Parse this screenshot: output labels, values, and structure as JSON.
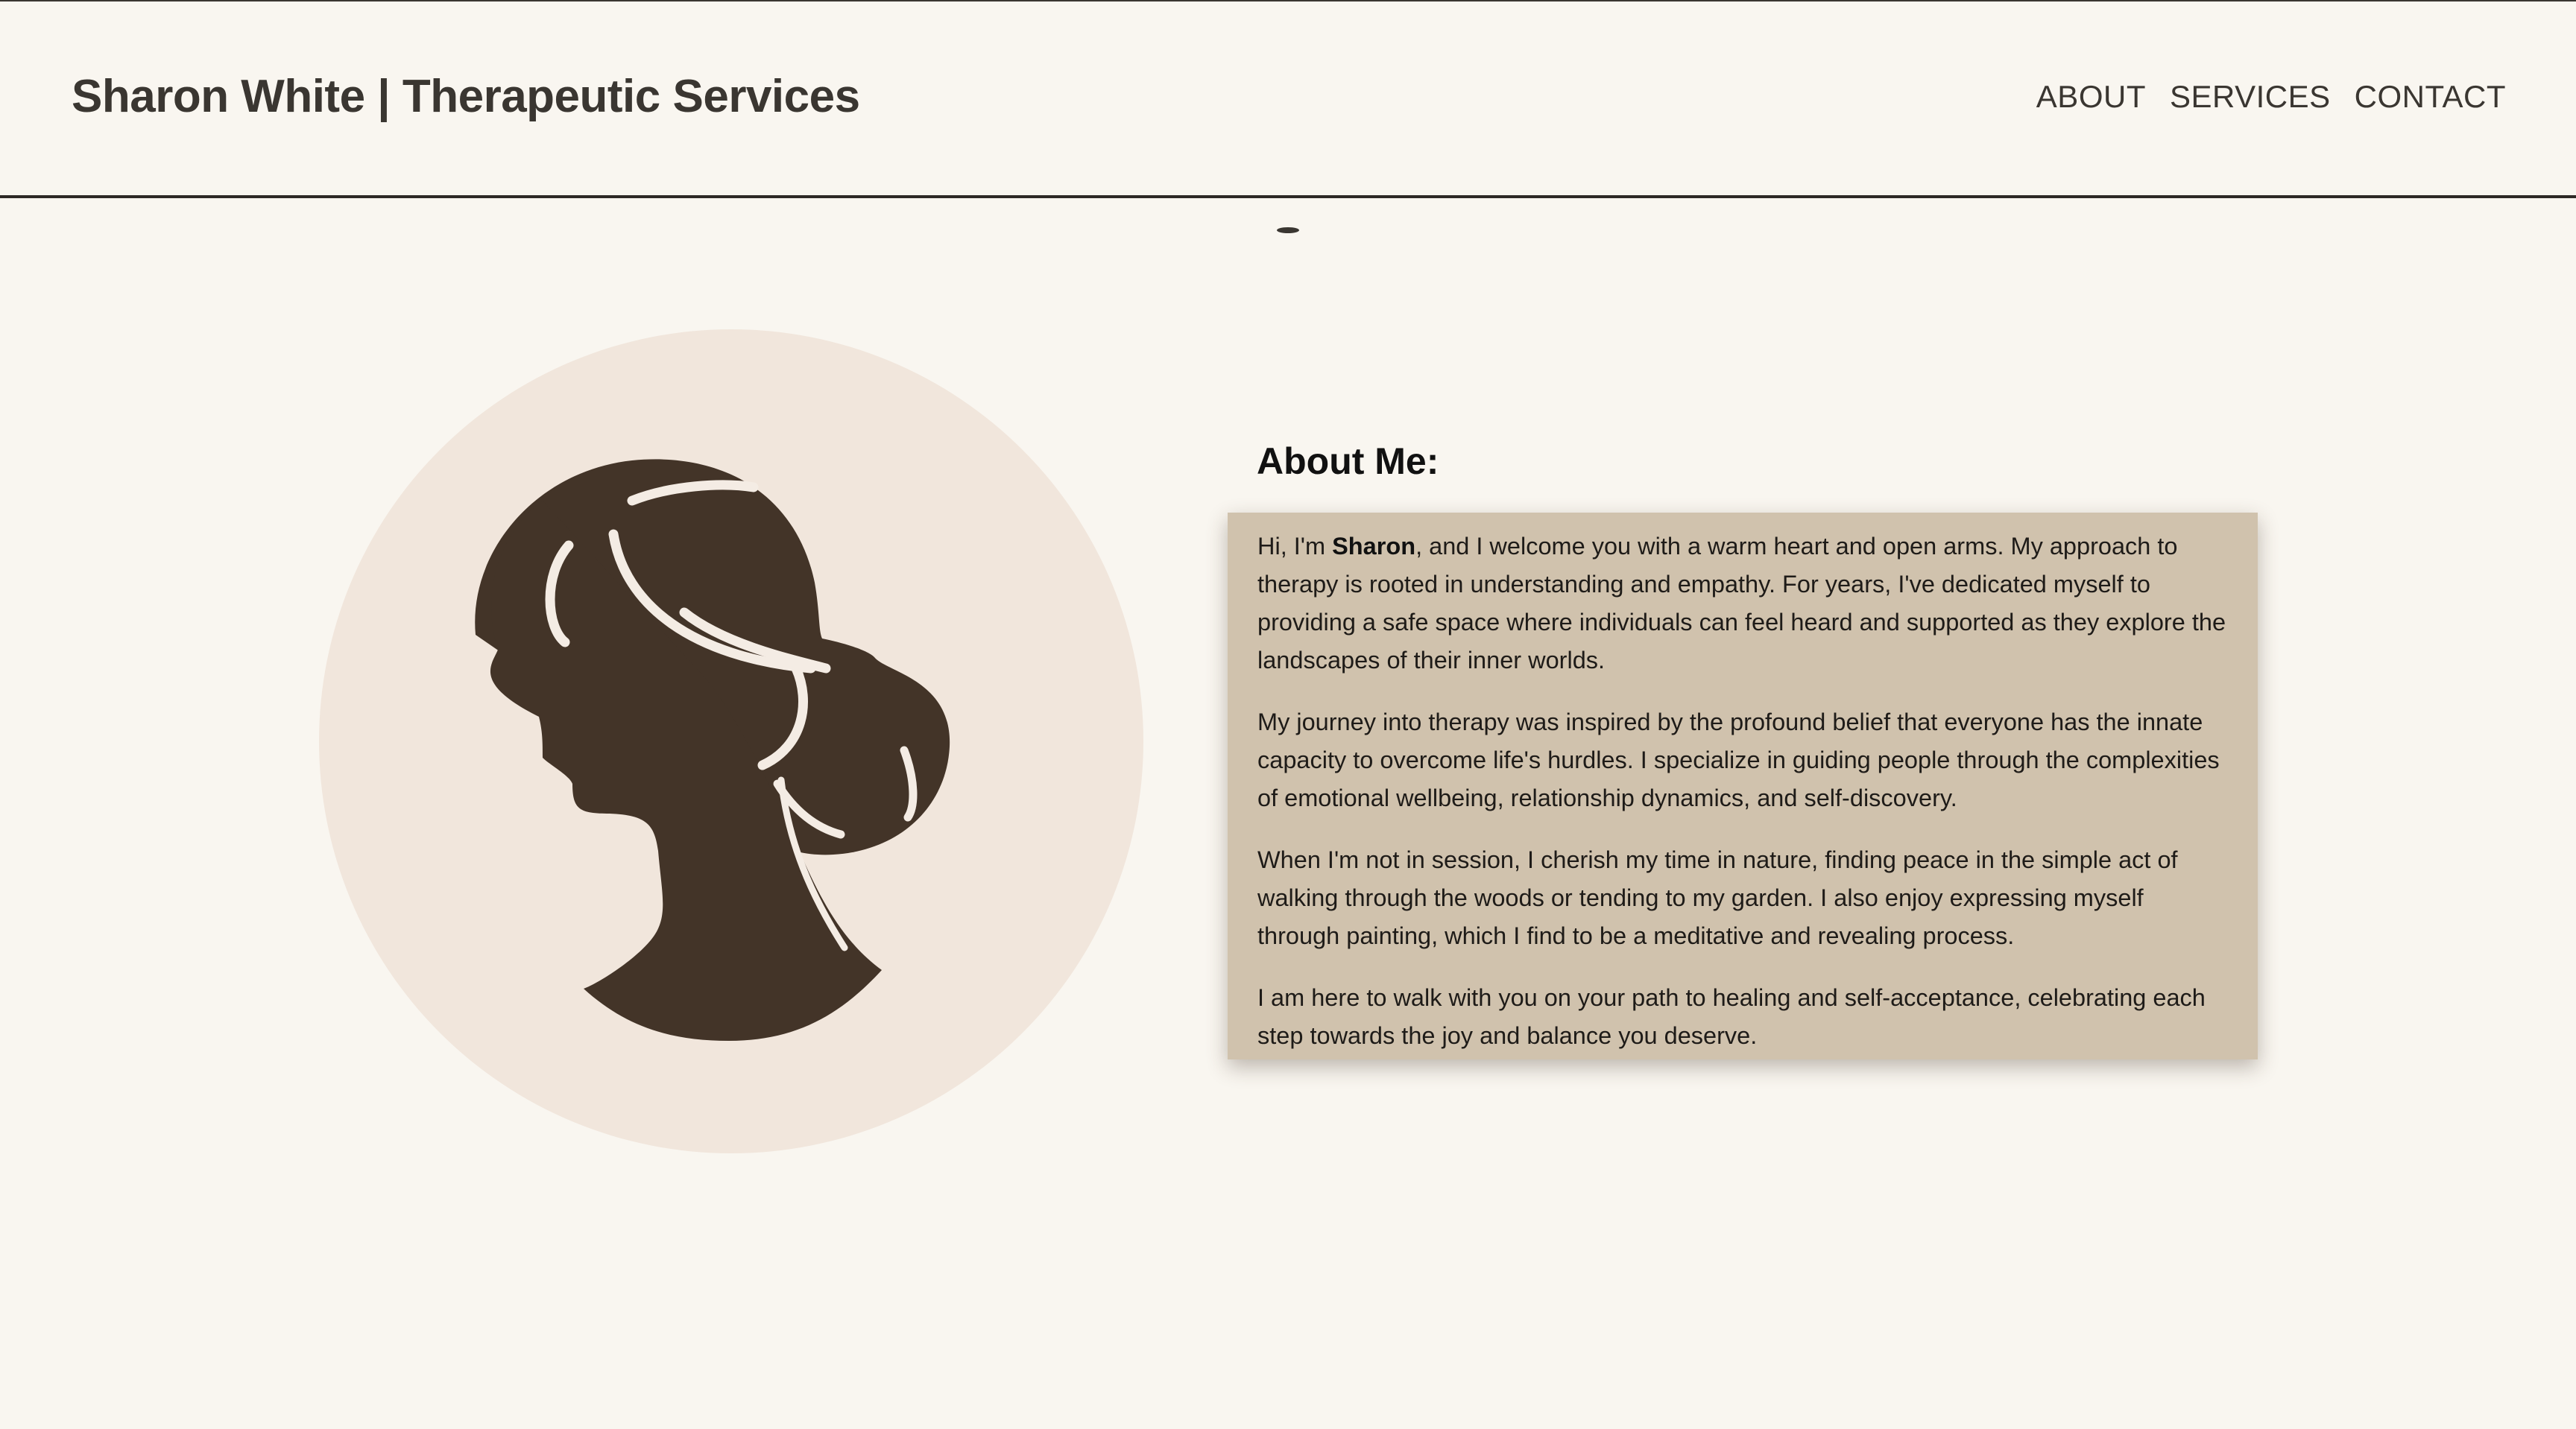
{
  "header": {
    "title": "Sharon White | Therapeutic Services",
    "nav": [
      {
        "label": "ABOUT"
      },
      {
        "label": "SERVICES"
      },
      {
        "label": "CONTACT"
      }
    ]
  },
  "avatar": {
    "icon": "woman-silhouette-icon",
    "circle_color": "#f1e6dc",
    "silhouette_color": "#433428"
  },
  "about": {
    "heading": "About Me:",
    "paragraphs": [
      {
        "intro": "Hi, I'm ",
        "name": "Sharon",
        "rest": ", and I welcome you with a warm heart and open arms. My approach to therapy is rooted in understanding and empathy. For years, I've dedicated myself to providing a safe space where individuals can feel heard and supported as they explore the landscapes of their inner worlds."
      },
      {
        "text": "My journey into therapy was inspired by the profound belief that everyone has the innate capacity to overcome life's hurdles. I specialize in guiding people through the complexities of emotional wellbeing, relationship dynamics, and self-discovery."
      },
      {
        "text": "When I'm not in session, I cherish my time in nature, finding peace in the simple act of walking through the woods or tending to my garden. I also enjoy expressing myself through painting, which I find to be a meditative and revealing process."
      },
      {
        "text": "I am here to walk with you on your path to healing and self-acceptance, celebrating each step towards the joy and balance you deserve."
      }
    ],
    "box_color": "#d0c2ad"
  },
  "colors": {
    "background": "#f9f6f0",
    "text": "#3a3631"
  }
}
